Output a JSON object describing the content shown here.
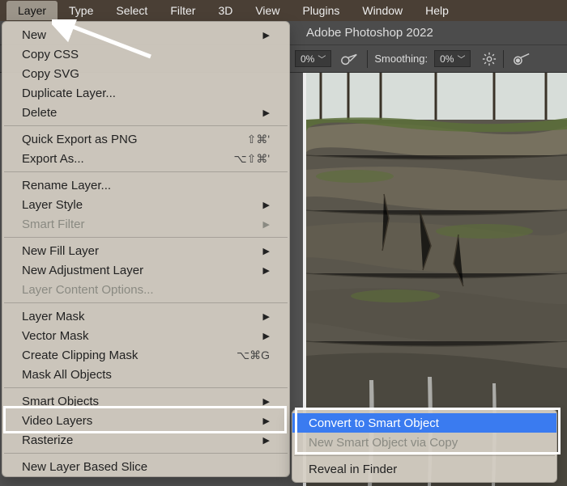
{
  "menubar": {
    "items": [
      "Layer",
      "Type",
      "Select",
      "Filter",
      "3D",
      "View",
      "Plugins",
      "Window",
      "Help"
    ],
    "active_index": 0
  },
  "app_title": "Adobe Photoshop 2022",
  "option_bar": {
    "opacity_value": "0%",
    "smoothing_label": "Smoothing:",
    "smoothing_value": "0%"
  },
  "layer_menu": [
    {
      "label": "New",
      "submenu": true
    },
    {
      "label": "Copy CSS"
    },
    {
      "label": "Copy SVG"
    },
    {
      "label": "Duplicate Layer..."
    },
    {
      "label": "Delete",
      "submenu": true
    },
    {
      "sep": true
    },
    {
      "label": "Quick Export as PNG",
      "shortcut": "⇧⌘'"
    },
    {
      "label": "Export As...",
      "shortcut": "⌥⇧⌘'"
    },
    {
      "sep": true
    },
    {
      "label": "Rename Layer..."
    },
    {
      "label": "Layer Style",
      "submenu": true
    },
    {
      "label": "Smart Filter",
      "disabled": true,
      "submenu": true
    },
    {
      "sep": true
    },
    {
      "label": "New Fill Layer",
      "submenu": true
    },
    {
      "label": "New Adjustment Layer",
      "submenu": true
    },
    {
      "label": "Layer Content Options...",
      "disabled": true
    },
    {
      "sep": true
    },
    {
      "label": "Layer Mask",
      "submenu": true
    },
    {
      "label": "Vector Mask",
      "submenu": true
    },
    {
      "label": "Create Clipping Mask",
      "shortcut": "⌥⌘G"
    },
    {
      "label": "Mask All Objects"
    },
    {
      "sep": true
    },
    {
      "label": "Smart Objects",
      "submenu": true,
      "highlighted": true
    },
    {
      "label": "Video Layers",
      "submenu": true
    },
    {
      "label": "Rasterize",
      "submenu": true
    },
    {
      "sep": true
    },
    {
      "label": "New Layer Based Slice"
    }
  ],
  "smart_objects_submenu": [
    {
      "label": "Convert to Smart Object",
      "hover": true
    },
    {
      "label": "New Smart Object via Copy",
      "disabled": true
    },
    {
      "sep": true
    },
    {
      "label": "Reveal in Finder"
    }
  ]
}
